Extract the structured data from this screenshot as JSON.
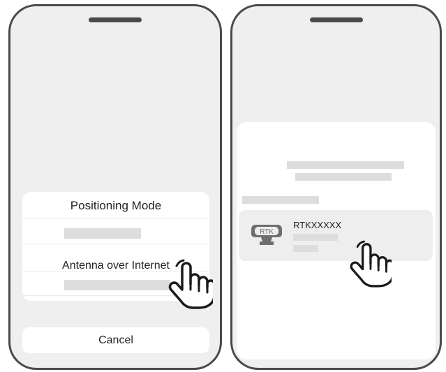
{
  "left_phone": {
    "sheet_title": "Positioning Mode",
    "selected_option": "Antenna over Internet",
    "cancel_label": "Cancel"
  },
  "right_phone": {
    "device": {
      "icon_text": "RTK",
      "name": "RTKXXXXX"
    }
  },
  "icons": [
    "hand-pointer-icon",
    "rtk-antenna-icon"
  ],
  "colors": {
    "frame": "#4a4a4a",
    "screen_bg": "#efefef",
    "card_bg": "#ffffff",
    "placeholder": "#dddddd",
    "selected_row_bg": "#eeeeee"
  }
}
